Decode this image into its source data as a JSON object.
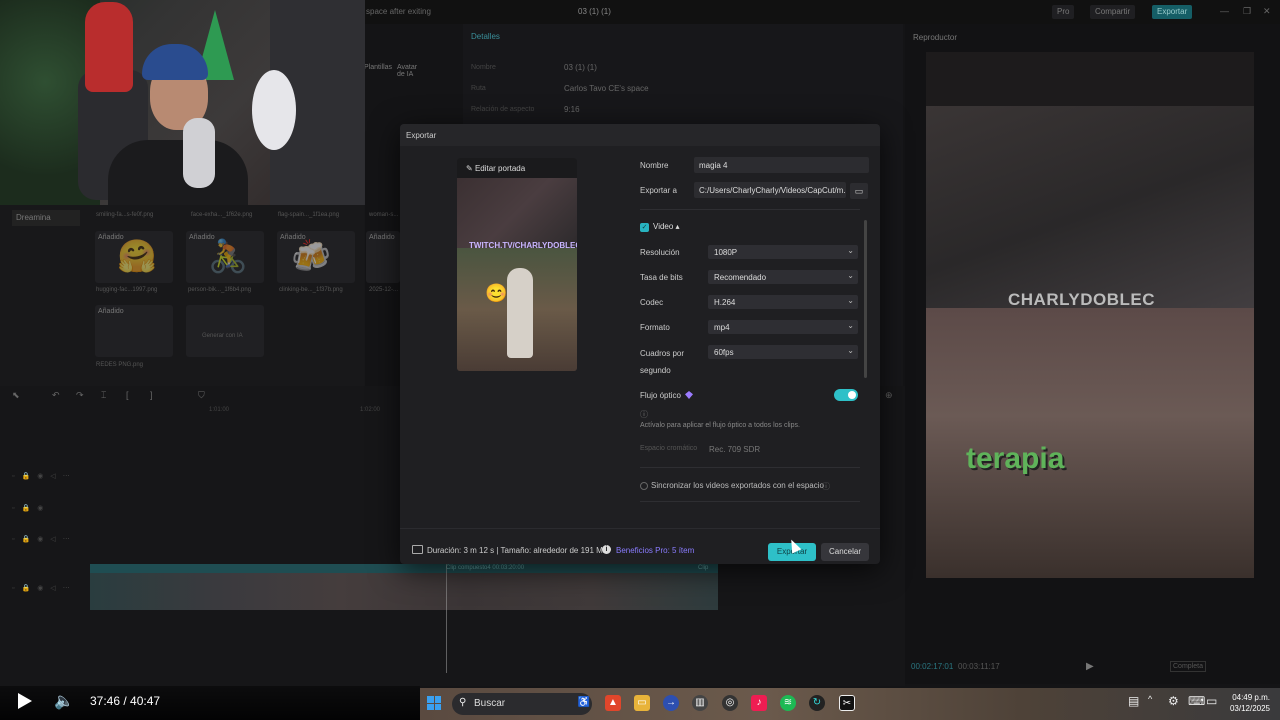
{
  "titlebar": {
    "left_text": "space after exiting",
    "project_title": "03 (1) (1)",
    "pro_label": "Pro",
    "share_label": "Compartir",
    "export_label": "Exportar"
  },
  "left_panel": {
    "tabs": [
      "Plantillas",
      "Avatar de IA"
    ],
    "dreamina": "Dreamina",
    "assets": [
      {
        "tag": "Añadido",
        "label": "hugging-fac...1997.png"
      },
      {
        "tag": "Añadido",
        "label": "person-bik..._1f6b4.png"
      },
      {
        "tag": "Añadido",
        "label": "clinking-be..._1f37b.png"
      },
      {
        "tag": "Añadido",
        "label": "2025-12-..."
      },
      {
        "tag": "Añadido",
        "label": "REDES PNG.png"
      }
    ],
    "top_labels": [
      "smiling-fa...s-fe0f.png",
      "face-exha..._1f62e.png",
      "flag-spain..._1f1ea.png",
      "woman-s..."
    ],
    "generate_label": "Generar con IA"
  },
  "details": {
    "header": "Detalles",
    "rows": [
      {
        "label": "Nombre",
        "value": "03 (1) (1)"
      },
      {
        "label": "Ruta",
        "value": "Carlos Tavo CE's space"
      },
      {
        "label": "Relación de aspecto",
        "value": "9:16"
      }
    ]
  },
  "player": {
    "header": "Reproductor",
    "instagram_text": "CHARLYDOBLEC",
    "overlay_text": "terapia",
    "time_current": "00:02:17:01",
    "time_total": "00:03:11:17",
    "completa": "Completa"
  },
  "timeline": {
    "ruler": [
      "1:01:00",
      "1:02:00"
    ],
    "clip_labels": [
      "Clip compuesto4  00:03:20:00",
      "Clip"
    ]
  },
  "dialog": {
    "title": "Exportar",
    "cover_edit": "Editar portada",
    "cover_overlay": "TWITCH.TV/CHARLYDOBLEC",
    "name_label": "Nombre",
    "name_value": "magia 4",
    "export_to_label": "Exportar a",
    "export_path": "C:/Users/CharlyCharly/Videos/CapCut/m...",
    "video_section": "Video",
    "settings": [
      {
        "label": "Resolución",
        "value": "1080P"
      },
      {
        "label": "Tasa de bits",
        "value": "Recomendado"
      },
      {
        "label": "Codec",
        "value": "H.264"
      },
      {
        "label": "Formato",
        "value": "mp4"
      },
      {
        "label": "Cuadros por",
        "label2": "segundo",
        "value": "60fps"
      }
    ],
    "optical_flow_label": "Flujo óptico",
    "optical_flow_on": true,
    "optical_flow_hint": "Actívalo para aplicar el flujo óptico a todos los clips.",
    "color_space_label": "Espacio cromático",
    "color_space_value": "Rec. 709 SDR",
    "sync_label": "Sincronizar los videos exportados con el espacio",
    "footer_info": "Duración: 3 m 12 s | Tamaño: alrededor de 191 MB",
    "pro_benefits": "Beneficios Pro: 5 ítem",
    "export_button": "Exportar",
    "cancel_button": "Cancelar",
    "accent": "#2ec0c8"
  },
  "media_player": {
    "time": "37:46 / 40:47"
  },
  "taskbar": {
    "search_placeholder": "Buscar",
    "clock_time": "04:49 p.m.",
    "clock_date": "03/12/2025"
  }
}
